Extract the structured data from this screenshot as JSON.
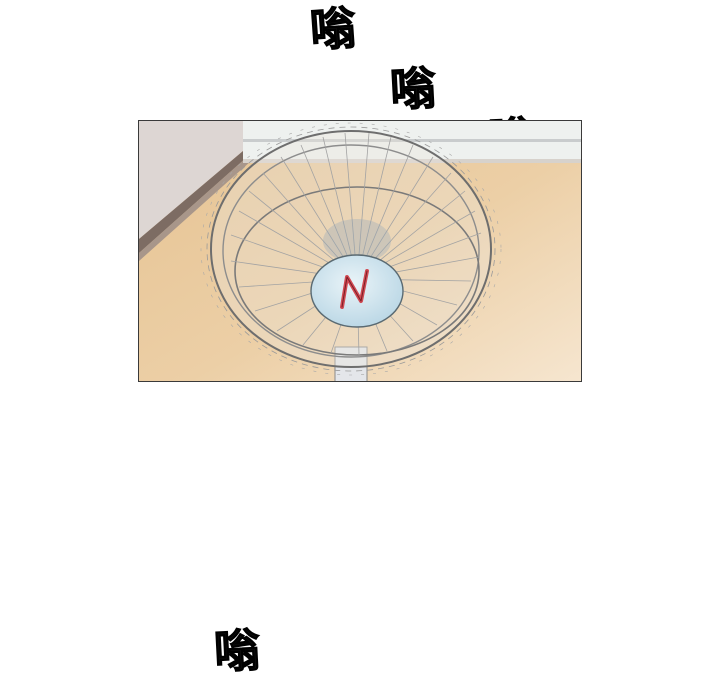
{
  "sound_effects": [
    {
      "text": "嗡"
    },
    {
      "text": "嗡"
    },
    {
      "text": "嗡"
    },
    {
      "text": "嗡"
    }
  ],
  "panel": {
    "subject": "electric-fan",
    "colors": {
      "floor": "#e8c79c",
      "floor_light": "#f3e3cc",
      "wall": "#ddd5d2",
      "baseboard": "#7a6a62",
      "window": "#f1f3f1",
      "fan_cage": "#9a9a9a",
      "fan_hub": "#cfe4ee",
      "hub_logo": "#d24a52"
    }
  }
}
